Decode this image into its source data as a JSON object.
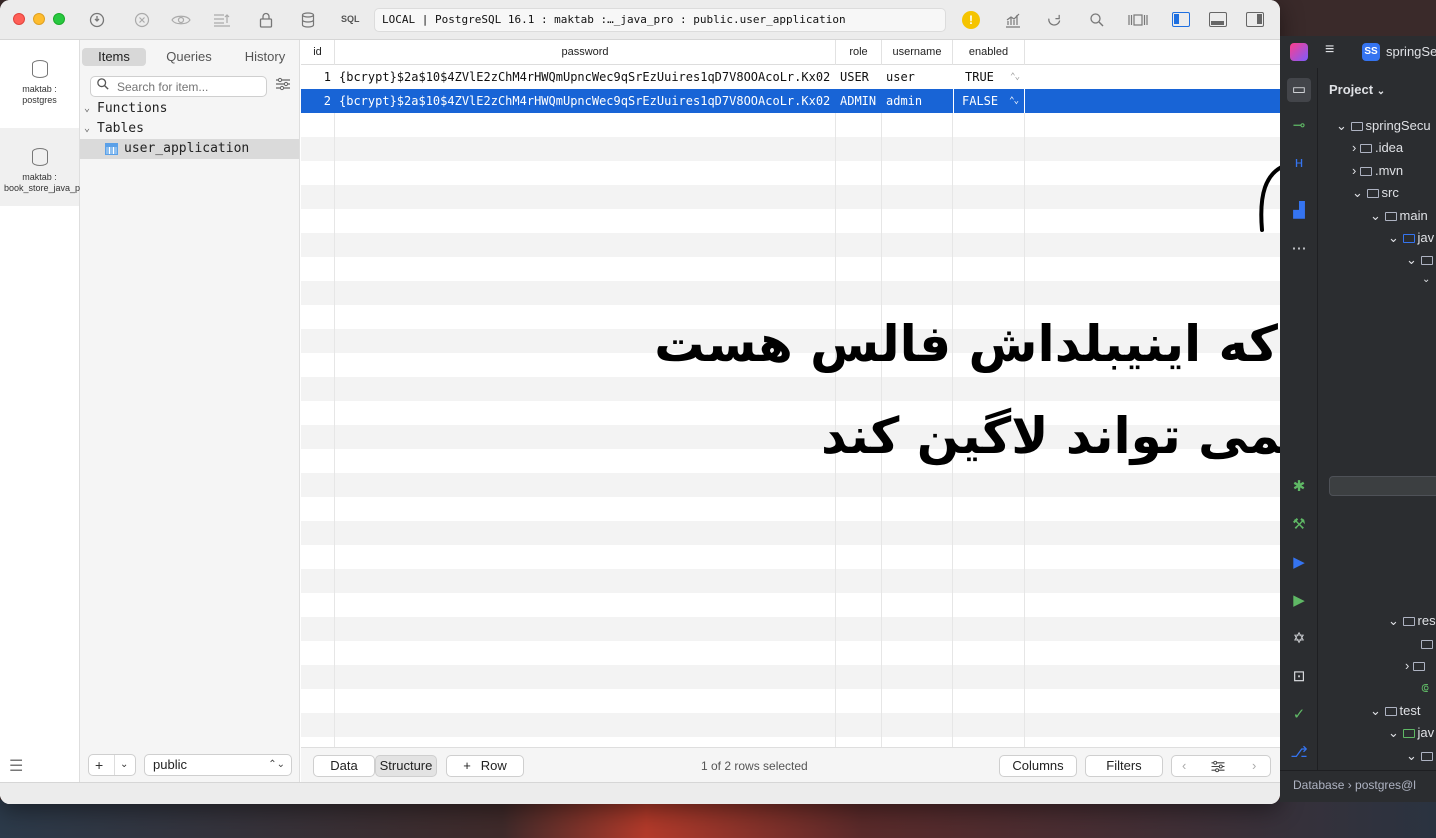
{
  "titlebar": {
    "sql_label": "SQL",
    "connection": "LOCAL | PostgreSQL 16.1 : maktab :…_java_pro : public.user_application",
    "warning_glyph": "!"
  },
  "rail": {
    "connections": [
      {
        "label": "maktab : postgres"
      },
      {
        "label": "maktab : book_store_java_pro"
      }
    ]
  },
  "sidebar": {
    "tabs": [
      "Items",
      "Queries",
      "History"
    ],
    "search_placeholder": "Search for item...",
    "tree": {
      "functions": "Functions",
      "tables": "Tables",
      "table_item": "user_application"
    },
    "schema": "public"
  },
  "grid": {
    "columns": [
      "id",
      "password",
      "role",
      "username",
      "enabled"
    ],
    "rows": [
      {
        "id": "1",
        "password": "{bcrypt}$2a$10$4ZVlE2zChM4rHWQmUpncWec9qSrEzUuires1qD7V8OOAcoLr.Kx02",
        "role": "USER",
        "username": "user",
        "enabled": "TRUE"
      },
      {
        "id": "2",
        "password": "{bcrypt}$2a$10$4ZVlE2zChM4rHWQmUpncWec9qSrEzUuires1qD7V8OOAcoLr.Kx02",
        "role": "ADMIN",
        "username": "admin",
        "enabled": "FALSE"
      }
    ],
    "selected_row": 2
  },
  "annotation": {
    "line1": "کاربری که اینیبلداش فالس هست",
    "line2": "نمی تواند لاگین کند"
  },
  "footer": {
    "data_tab": "Data",
    "structure_tab": "Structure",
    "add_row": "Row",
    "status": "1 of 2 rows selected",
    "columns_btn": "Columns",
    "filters_btn": "Filters"
  },
  "ide": {
    "project_badge": "SS",
    "project_name": "springSe",
    "panel_title": "Project",
    "tree": [
      "springSecu",
      ".idea",
      ".mvn",
      "src",
      "main",
      "jav",
      "res",
      "test",
      "jav"
    ],
    "status": "Database › postgres@l"
  },
  "colors": {
    "selection": "#1864d6",
    "accent": "#1e6fe0",
    "warning": "#f5c400"
  }
}
